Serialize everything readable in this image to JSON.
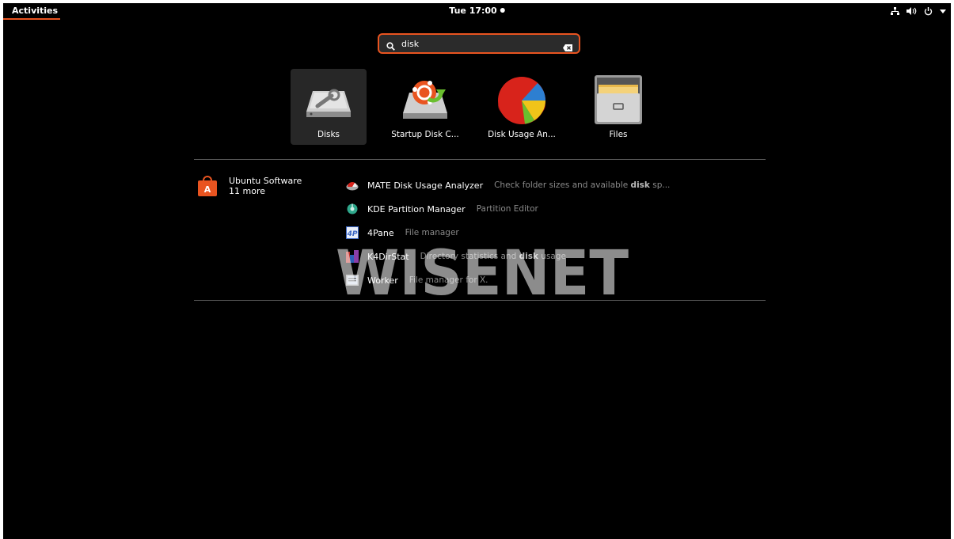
{
  "topbar": {
    "activities_label": "Activities",
    "clock": "Tue 17:00",
    "tray_icons": [
      "network-icon",
      "volume-icon",
      "power-icon",
      "dropdown-arrow-icon"
    ]
  },
  "search": {
    "value": "disk"
  },
  "apps": [
    {
      "label": "Disks",
      "icon": "disks-icon",
      "selected": true
    },
    {
      "label": "Startup Disk C...",
      "icon": "startup-disk-creator-icon"
    },
    {
      "label": "Disk Usage An...",
      "icon": "disk-usage-analyzer-icon"
    },
    {
      "label": "Files",
      "icon": "files-icon"
    }
  ],
  "provider": {
    "name": "Ubuntu Software",
    "more": "11 more",
    "icon": "ubuntu-software-icon"
  },
  "results": [
    {
      "name": "MATE Disk Usage Analyzer",
      "desc_before": "Check folder sizes and available ",
      "desc_bold": "disk",
      "desc_after": " sp...",
      "icon": "mate-disk-usage-icon"
    },
    {
      "name": "KDE Partition Manager",
      "desc_before": "Partition Editor",
      "desc_bold": "",
      "desc_after": "",
      "icon": "kde-partition-icon"
    },
    {
      "name": "4Pane",
      "desc_before": "File manager",
      "desc_bold": "",
      "desc_after": "",
      "icon": "4pane-icon"
    },
    {
      "name": "K4DirStat",
      "desc_before": "Directory statistics and ",
      "desc_bold": "disk",
      "desc_after": " usage",
      "icon": "k4dirstat-icon"
    },
    {
      "name": "Worker",
      "desc_before": "File manager for X.",
      "desc_bold": "",
      "desc_after": "",
      "icon": "worker-icon"
    }
  ],
  "watermark": {
    "text": "WISENET"
  },
  "colors": {
    "accent": "#e95420",
    "background": "#000000"
  }
}
